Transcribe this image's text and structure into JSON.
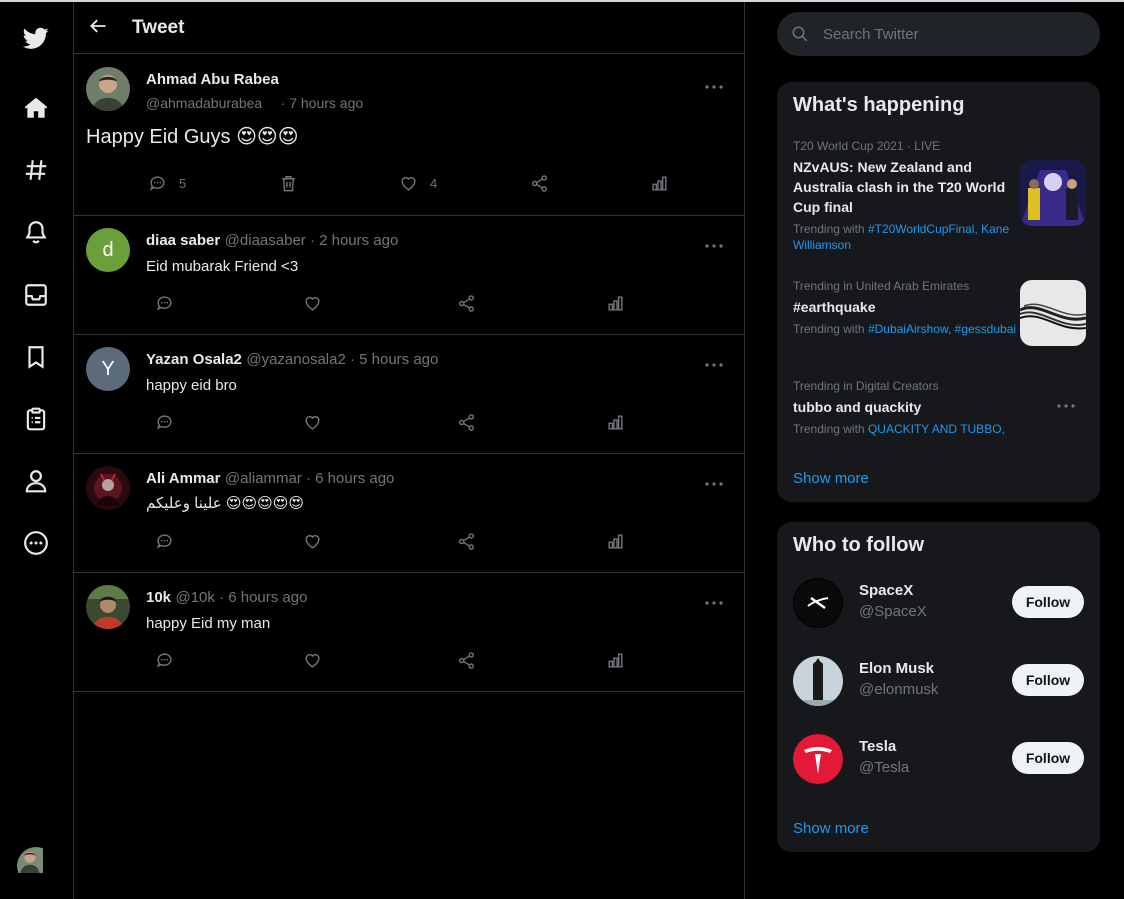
{
  "header": {
    "title": "Tweet"
  },
  "nav": {
    "items": [
      "twitter-logo",
      "home",
      "explore",
      "notifications",
      "messages",
      "bookmarks",
      "lists",
      "profile",
      "more"
    ]
  },
  "main_tweet": {
    "name": "Ahmad Abu Rabea",
    "handle": "@ahmadaburabea",
    "time": "· 7 hours ago",
    "text": "Happy Eid Guys 😍😍😍",
    "reply_count": "5",
    "like_count": "4"
  },
  "replies": [
    {
      "name": "diaa saber",
      "handle": "@diaasaber · 2 hours ago",
      "text": "Eid mubarak Friend <3",
      "avatar_letter": "d",
      "avatar_color": "#6a9f3a"
    },
    {
      "name": "Yazan Osala2",
      "handle": "@yazanosala2 · 5 hours ago",
      "text": "happy eid bro",
      "avatar_letter": "Y",
      "avatar_color": "#5b6b7a"
    },
    {
      "name": "Ali Ammar",
      "handle": "@aliammar · 6 hours ago",
      "text": "علينا وعليكم 😍😍😍😍😍",
      "avatar_letter": "",
      "avatar_color": "#3a1018"
    },
    {
      "name": "10k",
      "handle": "@10k · 6 hours ago",
      "text": "happy Eid my man",
      "avatar_letter": "",
      "avatar_color": "#3a4a30"
    }
  ],
  "search": {
    "placeholder": "Search Twitter"
  },
  "trends": {
    "title": "What's happening",
    "items": [
      {
        "context": "T20 World Cup 2021 · LIVE",
        "topic": "NZvAUS: New Zealand and Australia clash in the T20 World Cup final",
        "trending_prefix": "Trending with ",
        "trending_links": "#T20WorldCupFinal, Kane Williamson"
      },
      {
        "context": "Trending in United Arab Emirates",
        "topic": "#earthquake",
        "trending_prefix": "Trending with ",
        "trending_links": "#DubaiAirshow, #gessdubai"
      },
      {
        "context": "Trending in Digital Creators",
        "topic": "tubbo and quackity",
        "trending_prefix": "Trending with ",
        "trending_links": "QUACKITY AND TUBBO,"
      }
    ],
    "show_more": "Show more"
  },
  "who_to_follow": {
    "title": "Who to follow",
    "accounts": [
      {
        "name": "SpaceX",
        "handle": "@SpaceX",
        "button": "Follow"
      },
      {
        "name": "Elon Musk",
        "handle": "@elonmusk",
        "button": "Follow"
      },
      {
        "name": "Tesla",
        "handle": "@Tesla",
        "button": "Follow"
      }
    ],
    "show_more": "Show more"
  },
  "colors": {
    "accent": "#1d9bf0",
    "background": "#000000",
    "card": "#16181c",
    "muted": "#71767b"
  }
}
